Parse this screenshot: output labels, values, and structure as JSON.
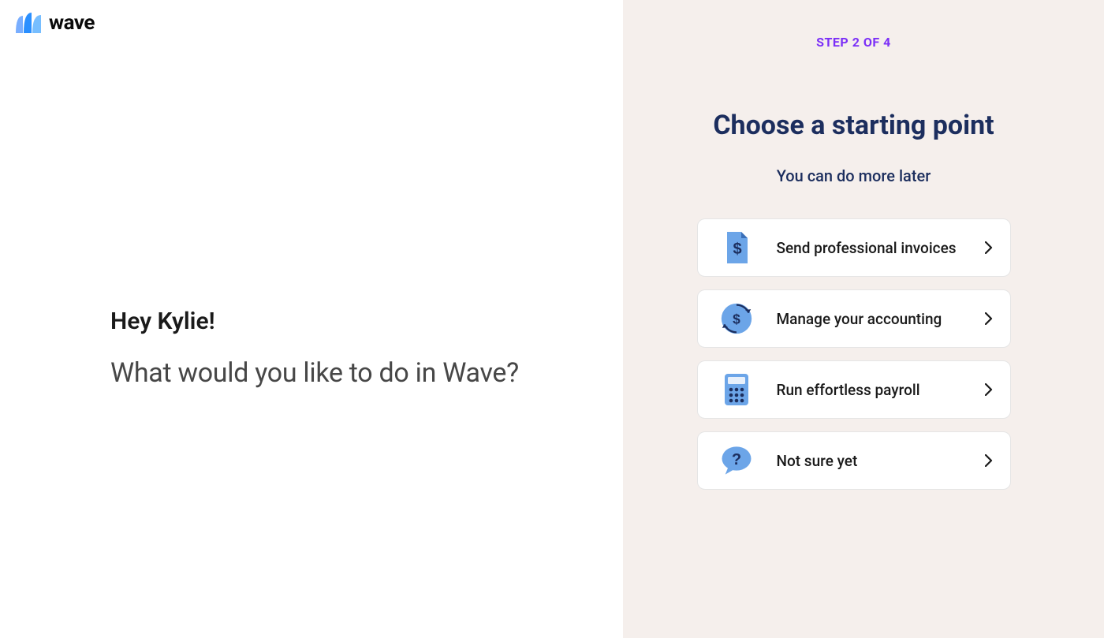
{
  "brand": {
    "name": "wave"
  },
  "left": {
    "greeting": "Hey Kylie!",
    "question": "What would you like to do in Wave?"
  },
  "right": {
    "step_label": "STEP 2 OF 4",
    "title": "Choose a starting point",
    "subtitle": "You can do more later",
    "options": [
      {
        "label": "Send professional invoices",
        "icon": "invoice-icon"
      },
      {
        "label": "Manage your accounting",
        "icon": "accounting-icon"
      },
      {
        "label": "Run effortless payroll",
        "icon": "payroll-icon"
      },
      {
        "label": "Not sure yet",
        "icon": "question-icon"
      }
    ]
  }
}
